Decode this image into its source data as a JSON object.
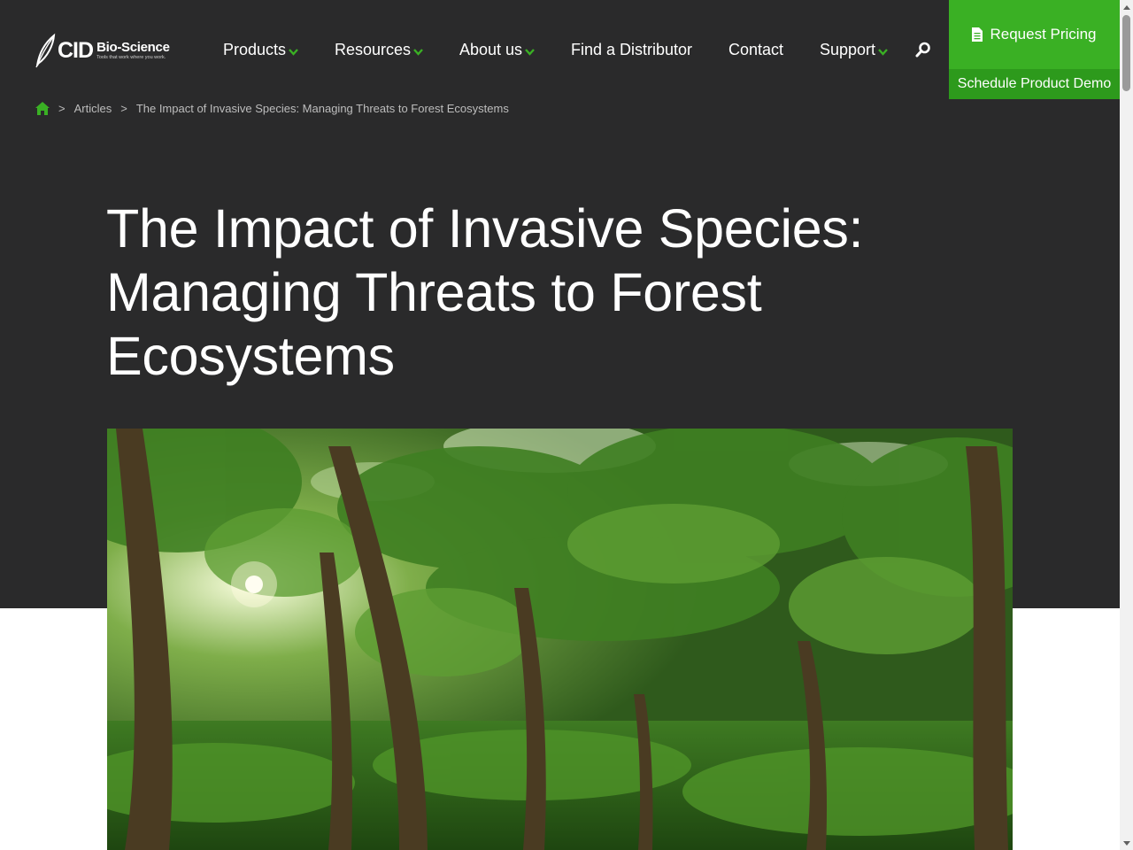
{
  "brand": {
    "name": "CID",
    "subname": "Bio-Science",
    "tagline": "Tools that work where you work.",
    "accent_color": "#3ab024",
    "dark_bg": "#2a2a2b"
  },
  "nav": {
    "items": [
      {
        "label": "Products",
        "has_dropdown": true
      },
      {
        "label": "Resources",
        "has_dropdown": true
      },
      {
        "label": "About us",
        "has_dropdown": true
      },
      {
        "label": "Find a Distributor",
        "has_dropdown": false
      },
      {
        "label": "Contact",
        "has_dropdown": false
      },
      {
        "label": "Support",
        "has_dropdown": true
      }
    ],
    "search_icon": "search-icon"
  },
  "cta": {
    "pricing_label": "Request Pricing",
    "pricing_icon": "document-icon",
    "demo_label": "Schedule Product Demo"
  },
  "breadcrumb": {
    "home_icon": "home-icon",
    "separator": ">",
    "items": [
      "Articles",
      "The Impact of Invasive Species: Managing Threats to Forest Ecosystems"
    ]
  },
  "article": {
    "title": "The Impact of Invasive Species: Managing Threats to Forest Ecosystems",
    "hero_image": "forest-canopy-image"
  }
}
